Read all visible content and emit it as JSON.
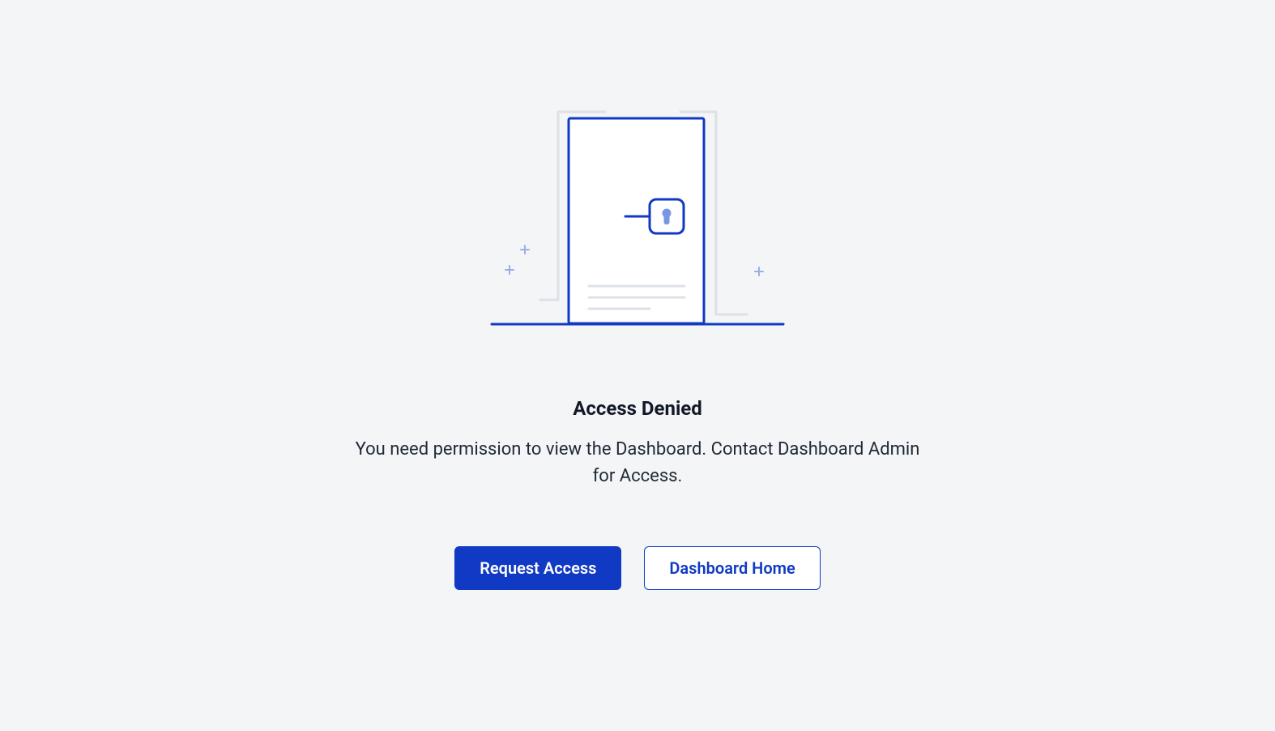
{
  "title": "Access Denied",
  "description": "You need permission to view the Dashboard. Contact Dashboard Admin for Access.",
  "buttons": {
    "primary": "Request Access",
    "secondary": "Dashboard Home"
  }
}
